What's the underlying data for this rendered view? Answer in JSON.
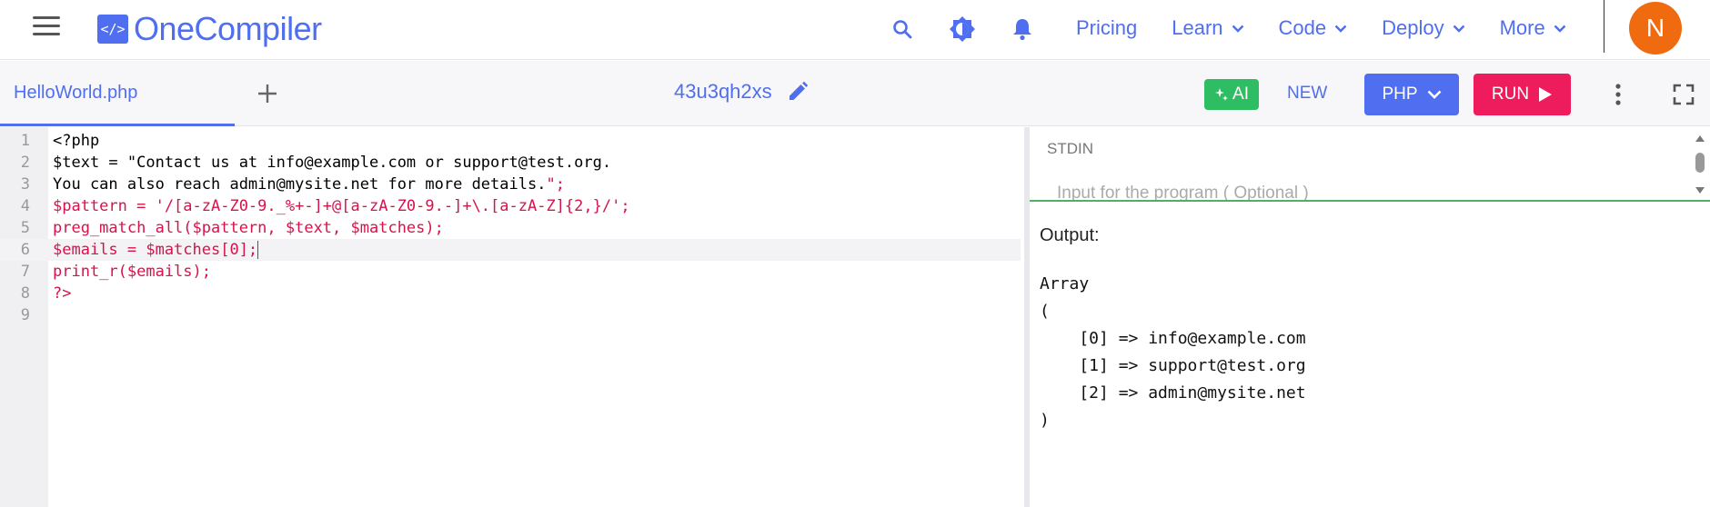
{
  "app": {
    "logo_mark": "</>",
    "logo_text": "OneCompiler"
  },
  "nav": {
    "links": [
      {
        "label": "Pricing",
        "dropdown": false
      },
      {
        "label": "Learn",
        "dropdown": true
      },
      {
        "label": "Code",
        "dropdown": true
      },
      {
        "label": "Deploy",
        "dropdown": true
      },
      {
        "label": "More",
        "dropdown": true
      }
    ],
    "icons": [
      "search-icon",
      "theme-toggle-icon",
      "notification-bell-icon"
    ],
    "avatar_initial": "N"
  },
  "toolbar": {
    "file_tab": "HelloWorld.php",
    "code_id": "43u3qh2xs",
    "ai_label": "AI",
    "new_label": "NEW",
    "language": "PHP",
    "run_label": "RUN"
  },
  "editor": {
    "active_line": 6,
    "lines": [
      {
        "n": "1",
        "segments": [
          {
            "t": "<?php",
            "c": "s"
          }
        ]
      },
      {
        "n": "2",
        "segments": [
          {
            "t": "$text = \"Contact us at info@example.com or support@test.org.",
            "c": "s"
          }
        ]
      },
      {
        "n": "3",
        "segments": [
          {
            "t": "You can also reach admin@mysite.net for more details.",
            "c": "s"
          },
          {
            "t": "\";",
            "c": "r"
          }
        ]
      },
      {
        "n": "4",
        "segments": [
          {
            "t": "$pattern = '/[a-zA-Z0-9._%+-]+@[a-zA-Z0-9.-]+\\.[a-zA-Z]{2,}/';",
            "c": "r"
          }
        ]
      },
      {
        "n": "5",
        "segments": [
          {
            "t": "preg_match_all($pattern, $text, $matches);",
            "c": "r"
          }
        ]
      },
      {
        "n": "6",
        "segments": [
          {
            "t": "$emails = $matches[0];",
            "c": "r"
          }
        ]
      },
      {
        "n": "7",
        "segments": [
          {
            "t": "print_r($emails);",
            "c": "r"
          }
        ]
      },
      {
        "n": "8",
        "segments": [
          {
            "t": "?>",
            "c": "r"
          }
        ]
      },
      {
        "n": "9",
        "segments": []
      }
    ]
  },
  "stdin": {
    "label": "STDIN",
    "placeholder": "Input for the program ( Optional )"
  },
  "output": {
    "label": "Output:",
    "text": "Array\n(\n    [0] => info@example.com\n    [1] => support@test.org\n    [2] => admin@mysite.net\n)"
  },
  "colors": {
    "accent": "#4f6ef0",
    "run": "#ee1c5c",
    "ai": "#2fbd63",
    "avatar": "#f06a10",
    "code_red": "#d8124a"
  }
}
